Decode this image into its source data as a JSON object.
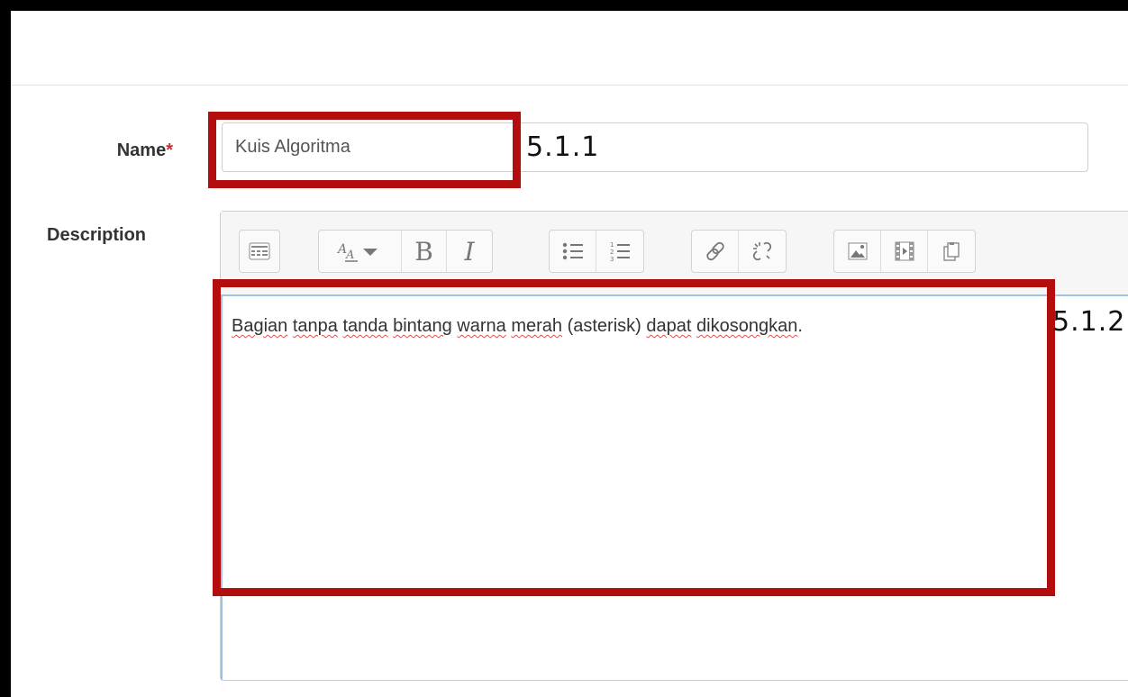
{
  "form": {
    "name_label": "Name",
    "required_mark": "*",
    "name_value": "Kuis Algoritma",
    "description_label": "Description"
  },
  "editor": {
    "toolbar": [
      {
        "group": "show-more",
        "icons": [
          "toolbar-toggle-icon"
        ]
      },
      {
        "group": "style",
        "icons": [
          "paragraph-styles-icon",
          "bold-icon",
          "italic-icon"
        ]
      },
      {
        "group": "lists",
        "icons": [
          "unordered-list-icon",
          "ordered-list-icon"
        ]
      },
      {
        "group": "links",
        "icons": [
          "link-icon",
          "unlink-icon"
        ]
      },
      {
        "group": "media",
        "icons": [
          "image-icon",
          "media-icon",
          "manage-files-icon"
        ]
      }
    ],
    "bold_glyph": "B",
    "italic_glyph": "I",
    "content_words": [
      "Bagian",
      "tanpa",
      "tanda",
      "bintang",
      "warna",
      "merah",
      "(asterisk)",
      "dapat",
      "dikosongkan",
      "."
    ]
  },
  "annotations": {
    "name_step": "5.1.1",
    "description_step": "5.1.2"
  },
  "colors": {
    "callout": "#b40d0d",
    "required": "#c9302c",
    "editor_focus": "#9ec3e4"
  }
}
